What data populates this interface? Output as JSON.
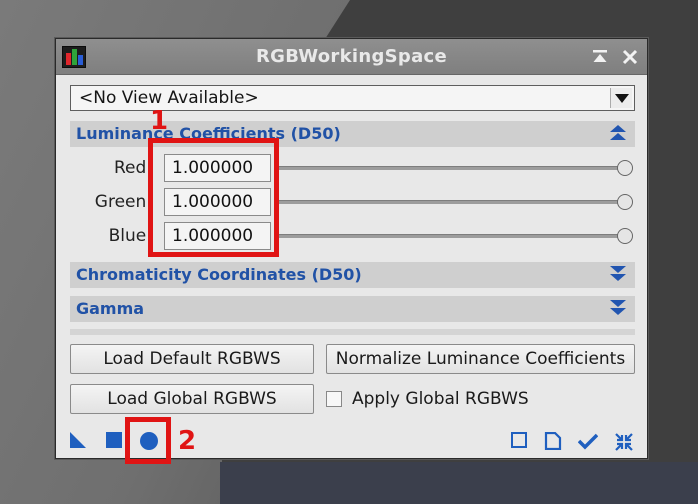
{
  "window": {
    "title": "RGBWorkingSpace"
  },
  "view_select": {
    "value": "<No View Available>"
  },
  "sections": {
    "luminance": "Luminance Coefficients (D50)",
    "chromaticity": "Chromaticity Coordinates (D50)",
    "gamma": "Gamma"
  },
  "coefficients": [
    {
      "label": "Red:",
      "value": "1.000000"
    },
    {
      "label": "Green:",
      "value": "1.000000"
    },
    {
      "label": "Blue:",
      "value": "1.000000"
    }
  ],
  "buttons": {
    "load_default": "Load Default RGBWS",
    "normalize": "Normalize Luminance Coefficients",
    "load_global": "Load Global RGBWS"
  },
  "apply_global": {
    "label": "Apply Global RGBWS",
    "checked": false
  },
  "annotations": {
    "one": "1",
    "two": "2"
  },
  "colors": {
    "accent": "#2152a6",
    "annotation": "#e01414"
  },
  "icons": {
    "footer_left": [
      "new-instance-icon",
      "execute-square-icon",
      "global-apply-circle-icon"
    ],
    "footer_right": [
      "preview-square-icon",
      "document-icon",
      "checkmark-icon",
      "collapse-icon"
    ]
  }
}
